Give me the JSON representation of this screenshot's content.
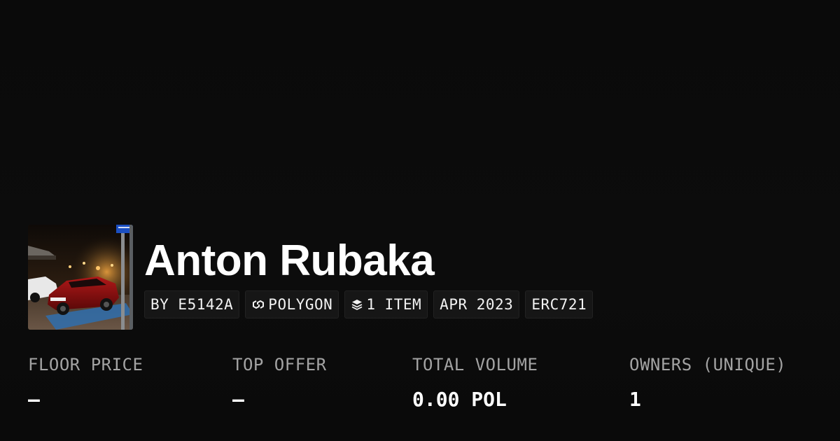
{
  "collection": {
    "name": "Anton Rubaka",
    "tags": {
      "creator": "BY E5142A",
      "chain": "POLYGON",
      "items": "1 ITEM",
      "date": "APR 2023",
      "standard": "ERC721"
    },
    "tag_icons": {
      "chain": "polygon-chain-icon",
      "items": "layers-stack-icon"
    }
  },
  "stats": {
    "floor_price": {
      "label": "FLOOR PRICE",
      "value": "—"
    },
    "top_offer": {
      "label": "TOP OFFER",
      "value": "—"
    },
    "total_volume": {
      "label": "TOTAL VOLUME",
      "value": "0.00 POL"
    },
    "owners": {
      "label": "OWNERS (UNIQUE)",
      "value": "1"
    }
  },
  "colors": {
    "background": "#0b0b0b",
    "text": "#ffffff",
    "muted": "#a3a3a3",
    "tag_bg": "#161616"
  }
}
